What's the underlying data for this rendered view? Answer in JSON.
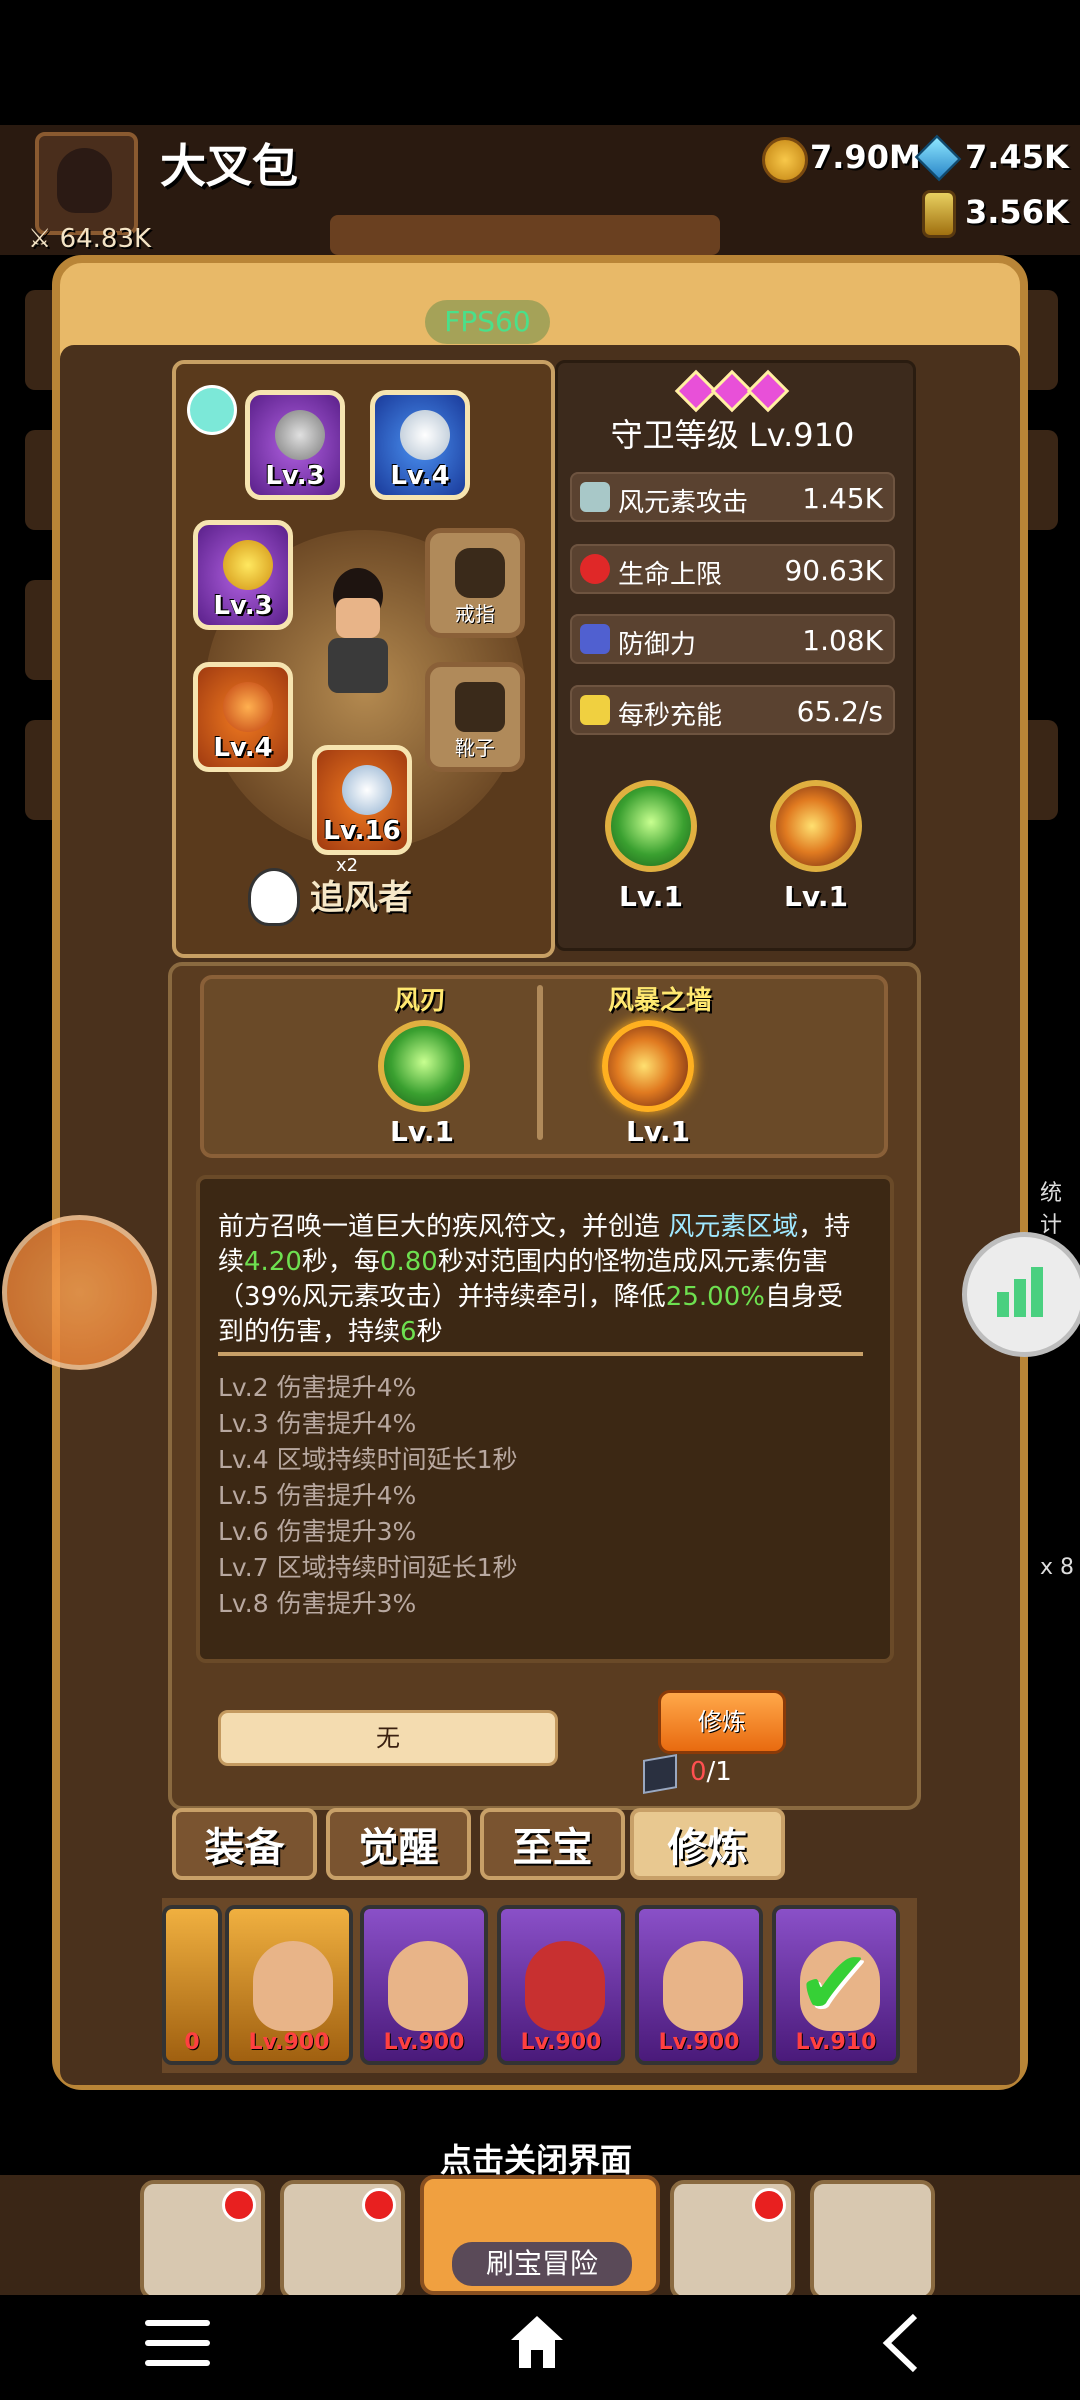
{
  "player": {
    "name": "大叉包",
    "power": "64.83K"
  },
  "resources": {
    "gold": "7.90M",
    "gems": "7.45K",
    "potion": "3.56K"
  },
  "fps": "FPS60",
  "equipment": {
    "slots": [
      {
        "lv": "Lv.3",
        "color": "purple",
        "icon": "vortex-icon"
      },
      {
        "lv": "Lv.4",
        "color": "blue",
        "icon": "necklace-icon"
      },
      {
        "lv": "Lv.3",
        "color": "purple",
        "icon": "helmet-icon"
      },
      {
        "lv": "Lv.4",
        "color": "orange",
        "icon": "armor-icon"
      },
      {
        "lv": "Lv.16",
        "color": "orange",
        "icon": "wings-emblem-icon"
      }
    ],
    "ring_label": "戒指",
    "boots_label": "靴子",
    "multiplier": "x2",
    "job_name": "追风者"
  },
  "stats": {
    "guard_level": "守卫等级 Lv.910",
    "rows": [
      {
        "name": "风元素攻击",
        "value": "1.45K",
        "icon": "wind-blade-icon"
      },
      {
        "name": "生命上限",
        "value": "90.63K",
        "icon": "heart-icon"
      },
      {
        "name": "防御力",
        "value": "1.08K",
        "icon": "shield-icon"
      },
      {
        "name": "每秒充能",
        "value": "65.2/s",
        "icon": "lightning-icon"
      }
    ],
    "skills": [
      {
        "lv": "Lv.1"
      },
      {
        "lv": "Lv.1"
      }
    ]
  },
  "skill_panel": {
    "skill1_name": "风刃",
    "skill1_lv": "Lv.1",
    "skill2_name": "风暴之墙",
    "skill2_lv": "Lv.1",
    "desc": {
      "p1": "前方召唤一道巨大的疾风符文，并创造",
      "p2": "风元素区域",
      "p3": "，持续",
      "v1": "4.20",
      "p4": "秒，每",
      "v2": "0.80",
      "p5": "秒对范围内的怪物造成风元素伤害（39%风元素攻击）并持续牵引，降低",
      "v3": "25.00%",
      "p6": "自身受到的伤害，持续",
      "v4": "6",
      "p7": "秒"
    },
    "levels": [
      "Lv.2 伤害提升4%",
      "Lv.3 伤害提升4%",
      "Lv.4 区域持续时间延长1秒",
      "Lv.5 伤害提升4%",
      "Lv.6 伤害提升3%",
      "Lv.7 区域持续时间延长1秒",
      "Lv.8 伤害提升3%"
    ],
    "none_label": "无",
    "train_button": "修炼",
    "count_have": "0",
    "count_need": "/1"
  },
  "tabs": [
    {
      "label": "装备",
      "active": false
    },
    {
      "label": "觉醒",
      "active": false
    },
    {
      "label": "至宝",
      "active": false
    },
    {
      "label": "修炼",
      "active": true
    }
  ],
  "roster": [
    {
      "lv": "0",
      "color": "orange"
    },
    {
      "lv": "Lv.900",
      "color": "orange"
    },
    {
      "lv": "Lv.900",
      "color": "purple"
    },
    {
      "lv": "Lv.900",
      "color": "purple"
    },
    {
      "lv": "Lv.900",
      "color": "purple"
    },
    {
      "lv": "Lv.910",
      "color": "purple",
      "selected": true
    }
  ],
  "close_tip": "点击关闭界面",
  "bottom": {
    "adventure_label": "刷宝冒险"
  },
  "side_text": {
    "right_stats": "统计",
    "right_x8": "x 8"
  }
}
